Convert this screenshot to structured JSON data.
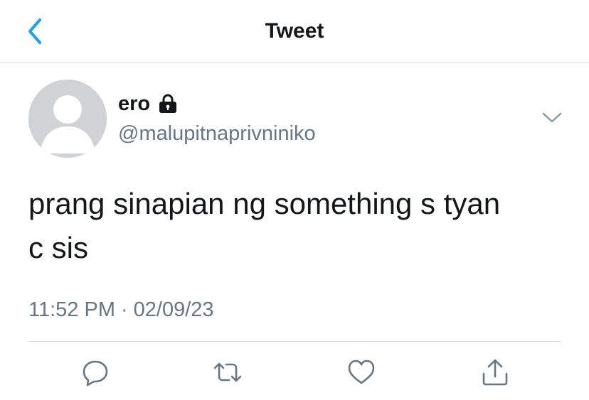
{
  "header": {
    "title": "Tweet",
    "back_icon": "chevron-left-icon",
    "accent_color": "#1da1f2"
  },
  "tweet": {
    "author": {
      "display_name": "ero",
      "handle": "@malupitnaprivniniko",
      "protected": true,
      "avatar": "default-avatar"
    },
    "text": "prang sinapian ng something s tyan\nc sis",
    "time": "11:52 PM",
    "separator": "·",
    "date": "02/09/23",
    "menu_icon": "chevron-down-icon"
  },
  "actions": [
    {
      "name": "reply",
      "icon": "reply-icon"
    },
    {
      "name": "retweet",
      "icon": "retweet-icon"
    },
    {
      "name": "like",
      "icon": "heart-icon"
    },
    {
      "name": "share",
      "icon": "share-icon"
    }
  ],
  "colors": {
    "text_primary": "#14171a",
    "text_secondary": "#657786",
    "divider": "#cfd5da",
    "avatar_bg": "#cfd3d6"
  }
}
